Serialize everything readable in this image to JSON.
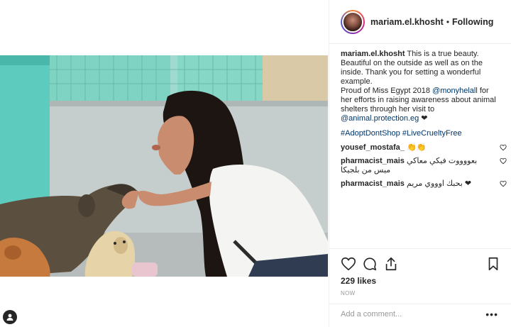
{
  "post": {
    "username": "mariam.el.khosht",
    "separator": "•",
    "follow_status": "Following",
    "caption_user": "mariam.el.khosht",
    "caption_text": "This is a true beauty. Beautiful on the outside as well as on the inside. Thank you for setting a wonderful example.",
    "caption_line2_prefix": "Proud of Miss Egypt 2018",
    "caption_mention1": "@monyhelall",
    "caption_line2_mid": "for her efforts in raising awareness about animal shelters through her visit to",
    "caption_mention2": "@animal.protection.eg",
    "caption_heart": "❤",
    "hashtag1": "#AdoptDontShop",
    "hashtag2": "#LiveCrueltyFree"
  },
  "comments": [
    {
      "user": "yousef_mostafa_",
      "text": "👏👏"
    },
    {
      "user": "pharmacist_mais",
      "text": "بعووووت فيكي معاكي ميس من بلجيكا"
    },
    {
      "user": "pharmacist_mais",
      "text": "بحبك اوووي مريم ❤"
    }
  ],
  "footer": {
    "likes": "229 likes",
    "time": "NOW",
    "add_comment_placeholder": "Add a comment...",
    "more_label": "•••"
  },
  "icons": {
    "like": "heart-outline-icon",
    "comment": "speech-bubble-icon",
    "share": "share-icon",
    "save": "bookmark-icon",
    "tag": "person-tag-icon"
  },
  "colors": {
    "link": "#003569",
    "muted": "#999999",
    "text": "#262626"
  }
}
